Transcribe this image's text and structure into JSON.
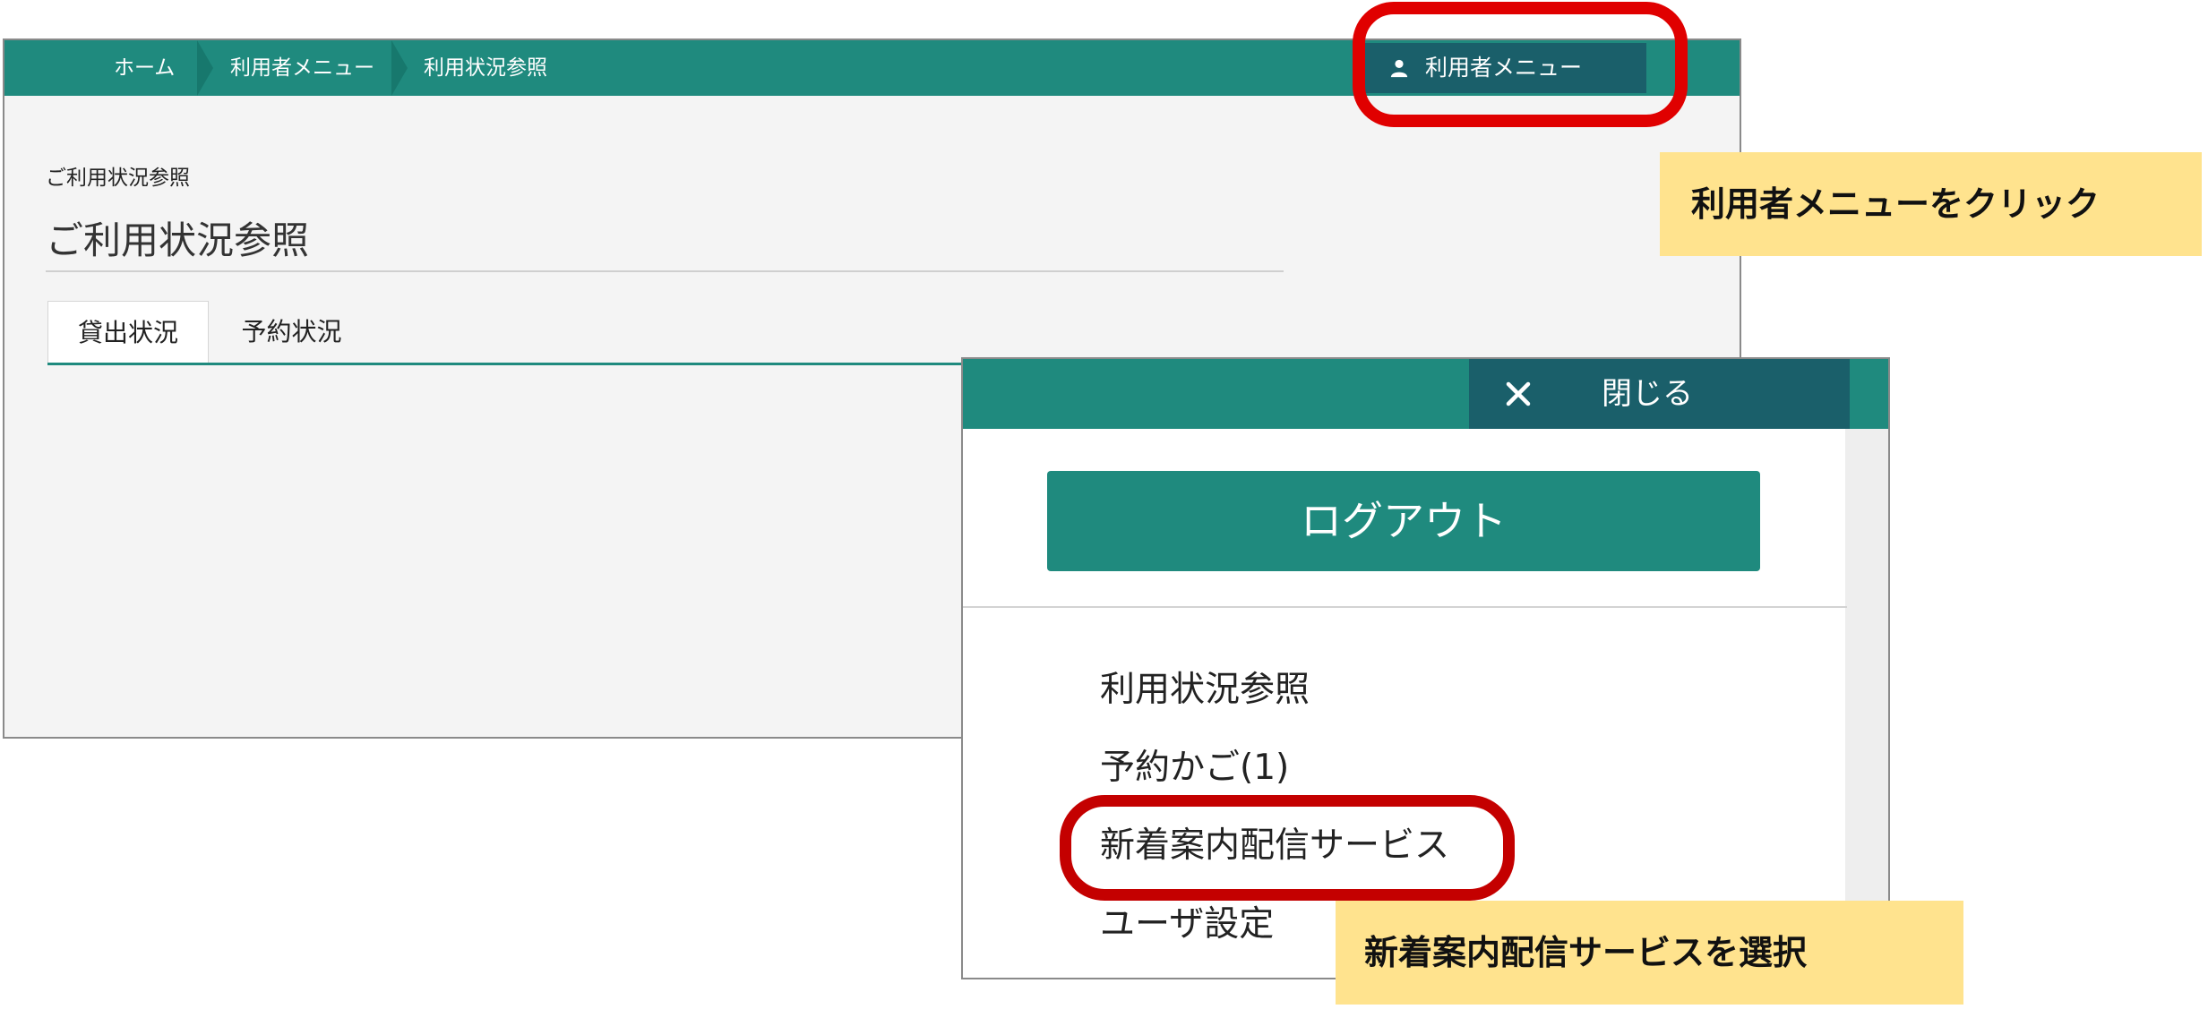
{
  "breadcrumb": [
    "ホーム",
    "利用者メニュー",
    "利用状況参照"
  ],
  "header": {
    "user_menu_label": "利用者メニュー"
  },
  "page": {
    "subtitle": "ご利用状況参照",
    "title": "ご利用状況参照",
    "tabs": [
      "貸出状況",
      "予約状況"
    ]
  },
  "menu_panel": {
    "close_label": "閉じる",
    "logout_label": "ログアウト",
    "items": [
      "利用状況参照",
      "予約かご(1)",
      "新着案内配信サービス",
      "ユーザ設定"
    ]
  },
  "annotations": {
    "step1": "利用者メニューをクリック",
    "step2": "新着案内配信サービスを選択"
  },
  "colors": {
    "teal": "#1f8a7e",
    "dark_teal": "#1a5f6a",
    "highlight_red": "#e00000",
    "callout_yellow": "#ffe38e"
  }
}
